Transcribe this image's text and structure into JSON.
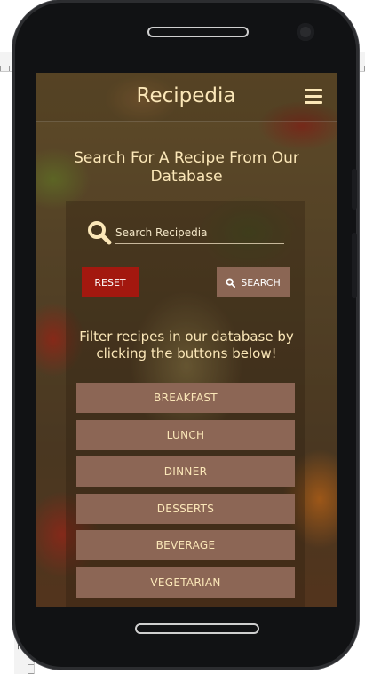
{
  "ruler": {
    "top_ticks": [
      "100",
      "200",
      "300"
    ],
    "left_ticks": [
      "100",
      "200",
      "300",
      "400",
      "500",
      "600",
      "700"
    ]
  },
  "app": {
    "brand": "Recipedia",
    "menu_icon": "hamburger-menu-icon"
  },
  "search": {
    "heading": "Search For A Recipe From Our Database",
    "placeholder": "Search Recipedia",
    "icon": "search-icon",
    "reset_label": "RESET",
    "search_label": "SEARCH"
  },
  "filters": {
    "intro": "Filter recipes in our database by clicking the buttons below!",
    "items": [
      {
        "label": "BREAKFAST"
      },
      {
        "label": "LUNCH"
      },
      {
        "label": "DINNER"
      },
      {
        "label": "DESSERTS"
      },
      {
        "label": "BEVERAGE"
      },
      {
        "label": "VEGETARIAN"
      }
    ]
  },
  "colors": {
    "brand_text": "#fbe7b8",
    "reset_button": "#a3180f",
    "search_button": "#8b6654",
    "filter_button": "#8c6655"
  }
}
